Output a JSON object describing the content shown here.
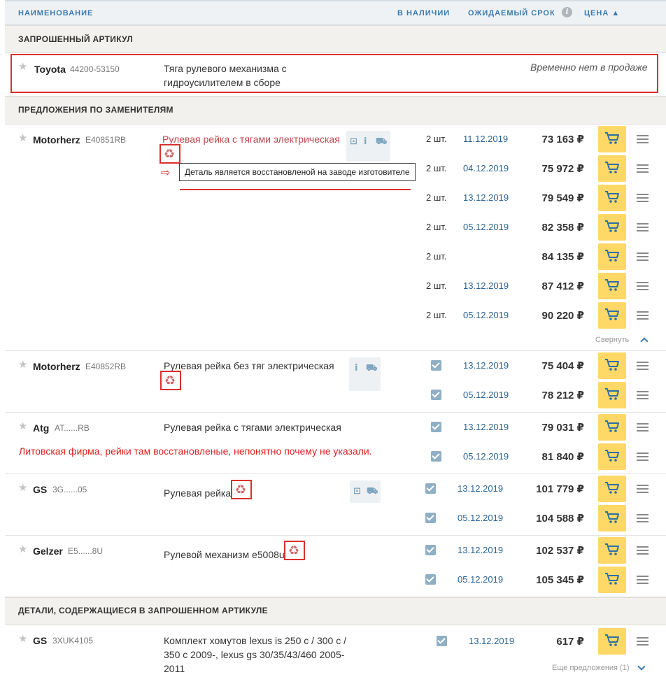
{
  "header": {
    "col_name": "НАИМЕНОВАНИЕ",
    "col_stock": "В НАЛИЧИИ",
    "col_term": "ОЖИДАЕМЫЙ СРОК",
    "col_info": "i",
    "col_price": "ЦЕНА ▲"
  },
  "sections": {
    "requested": "ЗАПРОШЕННЫЙ АРТИКУЛ",
    "substitutes": "ПРЕДЛОЖЕНИЯ ПО ЗАМЕНИТЕЛЯМ",
    "contained": "ДЕТАЛИ, СОДЕРЖАЩИЕСЯ В ЗАПРОШЕННОМ АРТИКУЛЕ"
  },
  "requested": {
    "brand": "Toyota",
    "article": "44200-53150",
    "desc_line1": "Тяга рулевого механизма с",
    "desc_line2": "гидроусилителем в сборе",
    "status": "Временно нет в продаже"
  },
  "tooltip": "Деталь является восстановленой на заводе изготовителе",
  "note": "Литовская фирма, рейки там восстановленые, непонятно почему не указали.",
  "collapse_label": "Свернуть",
  "more_offers": "Еще предложения (1)",
  "recycle_glyph": "♻",
  "item1": {
    "brand": "Motorherz",
    "article": "E40851RB",
    "desc": "Рулевая рейка с тягами электрическая",
    "offers": [
      {
        "qty": "2 шт.",
        "date": "11.12.2019",
        "price": "73 163 ₽"
      },
      {
        "qty": "2 шт.",
        "date": "04.12.2019",
        "price": "75 972 ₽"
      },
      {
        "qty": "2 шт.",
        "date": "13.12.2019",
        "price": "79 549 ₽"
      },
      {
        "qty": "2 шт.",
        "date": "05.12.2019",
        "price": "82 358 ₽"
      },
      {
        "qty": "2 шт.",
        "date": "",
        "price": "84 135 ₽"
      },
      {
        "qty": "2 шт.",
        "date": "13.12.2019",
        "price": "87 412 ₽"
      },
      {
        "qty": "2 шт.",
        "date": "05.12.2019",
        "price": "90 220 ₽"
      }
    ]
  },
  "item2": {
    "brand": "Motorherz",
    "article": "E40852RB",
    "desc": "Рулевая рейка без тяг электрическая",
    "offers": [
      {
        "date": "13.12.2019",
        "price": "75 404 ₽"
      },
      {
        "date": "05.12.2019",
        "price": "78 212 ₽"
      }
    ]
  },
  "item3": {
    "brand": "Atg",
    "article": "AT......RB",
    "desc": "Рулевая рейка с тягами электрическая",
    "offers": [
      {
        "date": "13.12.2019",
        "price": "79 031 ₽"
      },
      {
        "date": "05.12.2019",
        "price": "81 840 ₽"
      }
    ]
  },
  "item4": {
    "brand": "GS",
    "article": "3G......05",
    "desc": "Рулевая рейка",
    "offers": [
      {
        "date": "13.12.2019",
        "price": "101 779 ₽"
      },
      {
        "date": "05.12.2019",
        "price": "104 588 ₽"
      }
    ]
  },
  "item5": {
    "brand": "Gelzer",
    "article": "E5......8U",
    "desc": "Рулевой механизм e5008u",
    "offers": [
      {
        "date": "13.12.2019",
        "price": "102 537 ₽"
      },
      {
        "date": "05.12.2019",
        "price": "105 345 ₽"
      }
    ]
  },
  "item6": {
    "brand": "GS",
    "article": "3XUK4105",
    "desc_line1": "Комплект хомутов lexus is 250 c / 300 c /",
    "desc_line2": "350 c 2009-, lexus gs 30/35/43/460 2005-",
    "desc_line3": "2011",
    "offers": [
      {
        "date": "13.12.2019",
        "price": "617 ₽"
      }
    ]
  }
}
